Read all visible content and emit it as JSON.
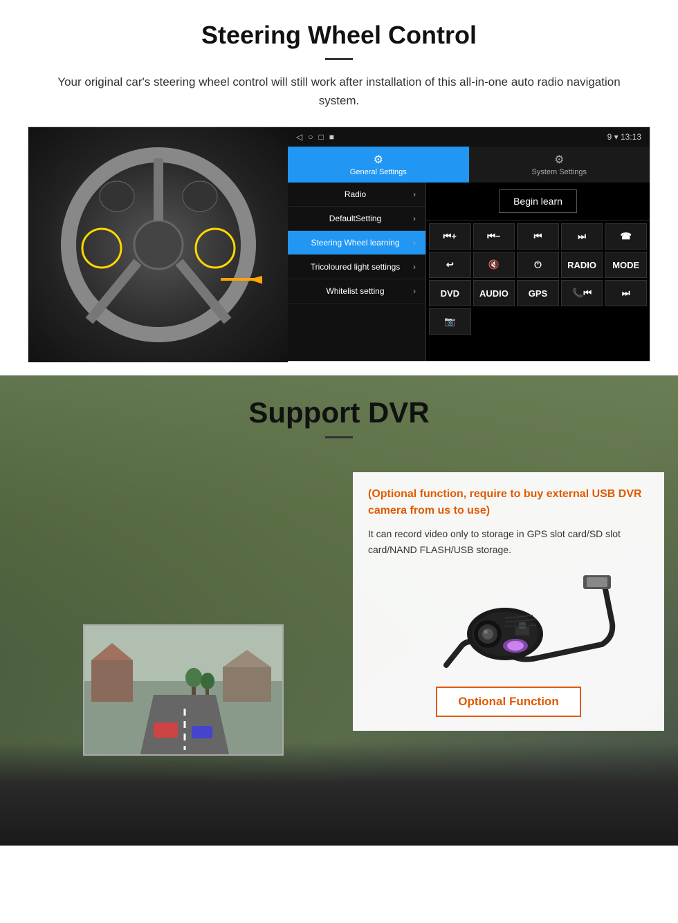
{
  "steering": {
    "title": "Steering Wheel Control",
    "subtitle": "Your original car's steering wheel control will still work after installation of this all-in-one auto radio navigation system.",
    "statusbar": {
      "icons": [
        "◁",
        "○",
        "□",
        "■"
      ],
      "right": "9 ▾ 13:13"
    },
    "tabs": [
      {
        "icon": "⚙",
        "label": "General Settings",
        "active": true
      },
      {
        "icon": "⚙",
        "label": "System Settings",
        "active": false
      }
    ],
    "menu_items": [
      {
        "label": "Radio",
        "active": false
      },
      {
        "label": "DefaultSetting",
        "active": false
      },
      {
        "label": "Steering Wheel learning",
        "active": true
      },
      {
        "label": "Tricoloured light settings",
        "active": false
      },
      {
        "label": "Whitelist setting",
        "active": false
      }
    ],
    "begin_learn": "Begin learn",
    "controls": [
      "⏮+",
      "⏮-",
      "⏮",
      "⏭",
      "☎",
      "↩",
      "🔇",
      "⏻",
      "RADIO",
      "MODE",
      "DVD",
      "AUDIO",
      "GPS",
      "📞⏮",
      "⏭"
    ],
    "extra_icon": "📷"
  },
  "dvr": {
    "title": "Support DVR",
    "card": {
      "title": "(Optional function, require to buy external USB DVR camera from us to use)",
      "body": "It can record video only to storage in GPS slot card/SD slot card/NAND FLASH/USB storage."
    },
    "optional_button_label": "Optional Function"
  }
}
